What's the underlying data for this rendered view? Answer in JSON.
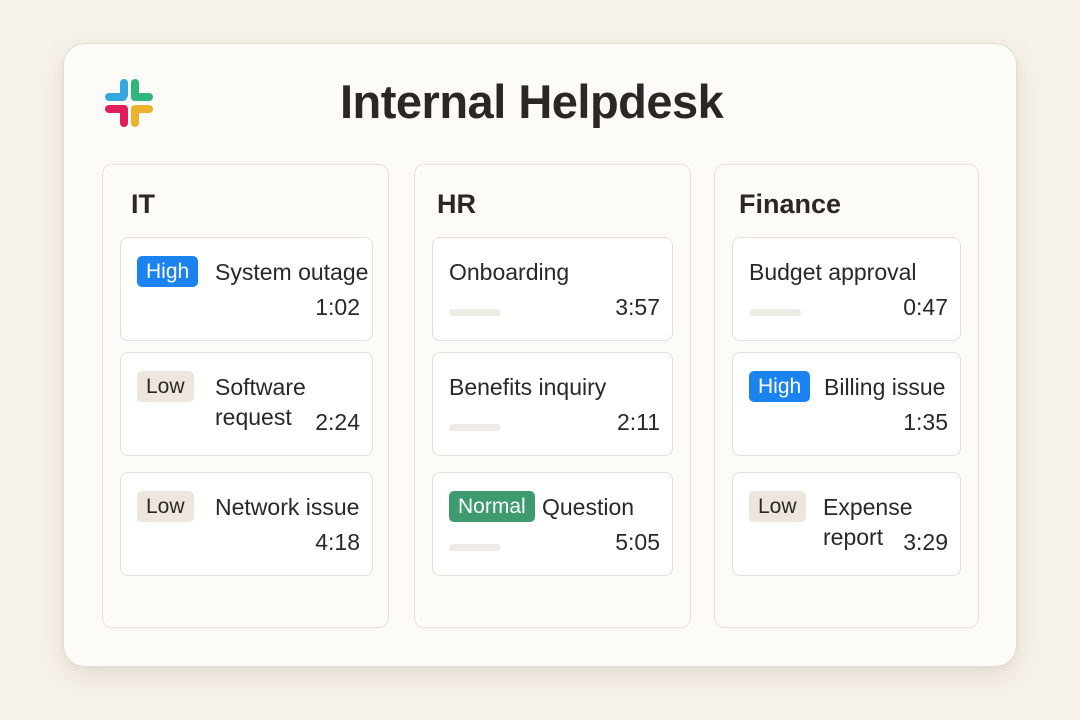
{
  "app": {
    "title": "Internal Helpdesk",
    "logo_icon": "slack-logo-icon"
  },
  "colors": {
    "high": "#1b83f0",
    "normal": "#3e9a6f",
    "low": "#ede6de"
  },
  "columns": [
    {
      "name": "IT",
      "tickets": [
        {
          "priority": "High",
          "title": "System outage",
          "time": "1:02"
        },
        {
          "priority": "Low",
          "title": "Software request",
          "time": "2:24"
        },
        {
          "priority": "Low",
          "title": "Network issue",
          "time": "4:18"
        }
      ]
    },
    {
      "name": "HR",
      "tickets": [
        {
          "priority": "",
          "title": "Onboarding",
          "time": "3:57"
        },
        {
          "priority": "",
          "title": "Benefits inquiry",
          "time": "2:11"
        },
        {
          "priority": "Normal",
          "title": "Question",
          "time": "5:05"
        }
      ]
    },
    {
      "name": "Finance",
      "tickets": [
        {
          "priority": "",
          "title": "Budget approval",
          "time": "0:47"
        },
        {
          "priority": "High",
          "title": "Billing issue",
          "time": "1:35"
        },
        {
          "priority": "Low",
          "title": "Expense report",
          "time": "3:29"
        }
      ]
    }
  ]
}
